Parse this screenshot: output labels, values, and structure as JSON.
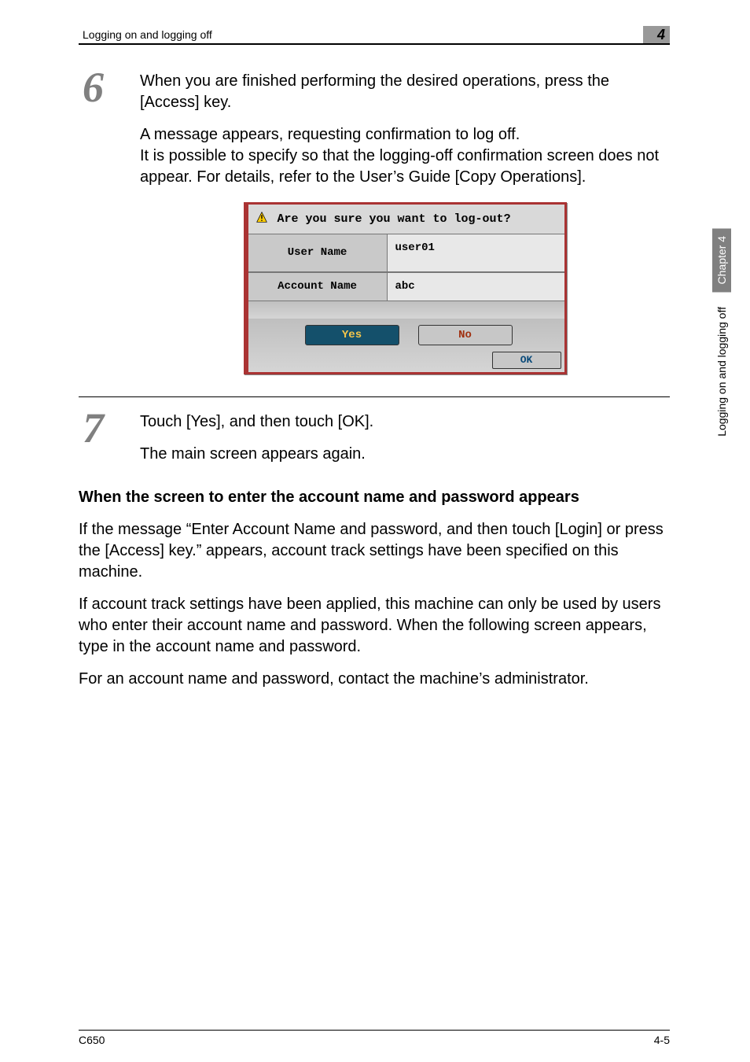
{
  "header": {
    "section": "Logging on and logging off",
    "chapter_tab": "4"
  },
  "side": {
    "chapter": "Chapter 4",
    "section": "Logging on and logging off"
  },
  "steps": {
    "six": {
      "num": "6",
      "p1": "When you are finished performing the desired operations, press the [Access] key.",
      "p2": "A message appears, requesting confirmation to log off.",
      "p3": "It is possible to specify so that the logging-off confirmation screen does not appear. For details, refer to the User’s Guide [Copy Operations]."
    },
    "seven": {
      "num": "7",
      "p1": "Touch [Yes], and then touch [OK].",
      "p2": "The main screen appears again."
    }
  },
  "dialog": {
    "title": "Are you sure you want to log-out?",
    "user_label": "User Name",
    "user_value": "user01",
    "account_label": "Account Name",
    "account_value": "abc",
    "yes": "Yes",
    "no": "No",
    "ok": "OK"
  },
  "section2": {
    "heading": "When the screen to enter the account name and password appears",
    "p1": "If the message “Enter Account Name and password, and then touch [Login] or press the [Access] key.” appears, account track settings have been specified on this machine.",
    "p2": "If account track settings have been applied, this machine can only be used by users who enter their account name and password. When the following screen appears, type in the account name and password.",
    "p3": "For an account name and password, contact the machine’s administrator."
  },
  "footer": {
    "left": "C650",
    "right": "4-5"
  }
}
